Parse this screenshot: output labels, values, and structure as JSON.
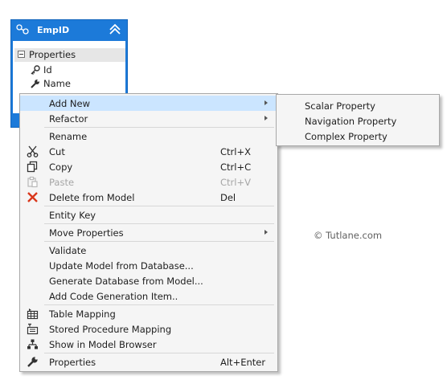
{
  "entity": {
    "name": "EmpID",
    "section_label": "Properties",
    "properties": [
      {
        "name": "Id",
        "icon": "key-property-icon"
      },
      {
        "name": "Name",
        "icon": "wrench-property-icon"
      }
    ]
  },
  "menu": {
    "items": [
      {
        "label": "Add New",
        "submenu": true
      },
      {
        "label": "Refactor",
        "submenu": true
      },
      {
        "label": "Rename"
      },
      {
        "label": "Cut",
        "shortcut": "Ctrl+X",
        "icon": "scissors-icon"
      },
      {
        "label": "Copy",
        "shortcut": "Ctrl+C",
        "icon": "copy-icon"
      },
      {
        "label": "Paste",
        "shortcut": "Ctrl+V",
        "icon": "paste-icon",
        "disabled": true
      },
      {
        "label": "Delete from Model",
        "shortcut": "Del",
        "icon": "delete-x-icon"
      },
      {
        "label": "Entity Key"
      },
      {
        "label": "Move Properties",
        "submenu": true
      },
      {
        "label": "Validate"
      },
      {
        "label": "Update Model from Database..."
      },
      {
        "label": "Generate Database from Model..."
      },
      {
        "label": "Add Code Generation Item.."
      },
      {
        "label": "Table Mapping",
        "icon": "table-mapping-icon"
      },
      {
        "label": "Stored Procedure Mapping",
        "icon": "stored-procedure-mapping-icon"
      },
      {
        "label": "Show in Model Browser",
        "icon": "model-browser-icon"
      },
      {
        "label": "Properties",
        "shortcut": "Alt+Enter",
        "icon": "wrench-icon"
      }
    ]
  },
  "submenu": {
    "items": [
      "Scalar Property",
      "Navigation Property",
      "Complex Property"
    ]
  },
  "watermark": "© Tutlane.com",
  "colors": {
    "entity_header": "#1c7ad9",
    "menu_background": "#f5f5f5",
    "highlight": "#cbe5ff",
    "delete_icon": "#d9371b"
  }
}
